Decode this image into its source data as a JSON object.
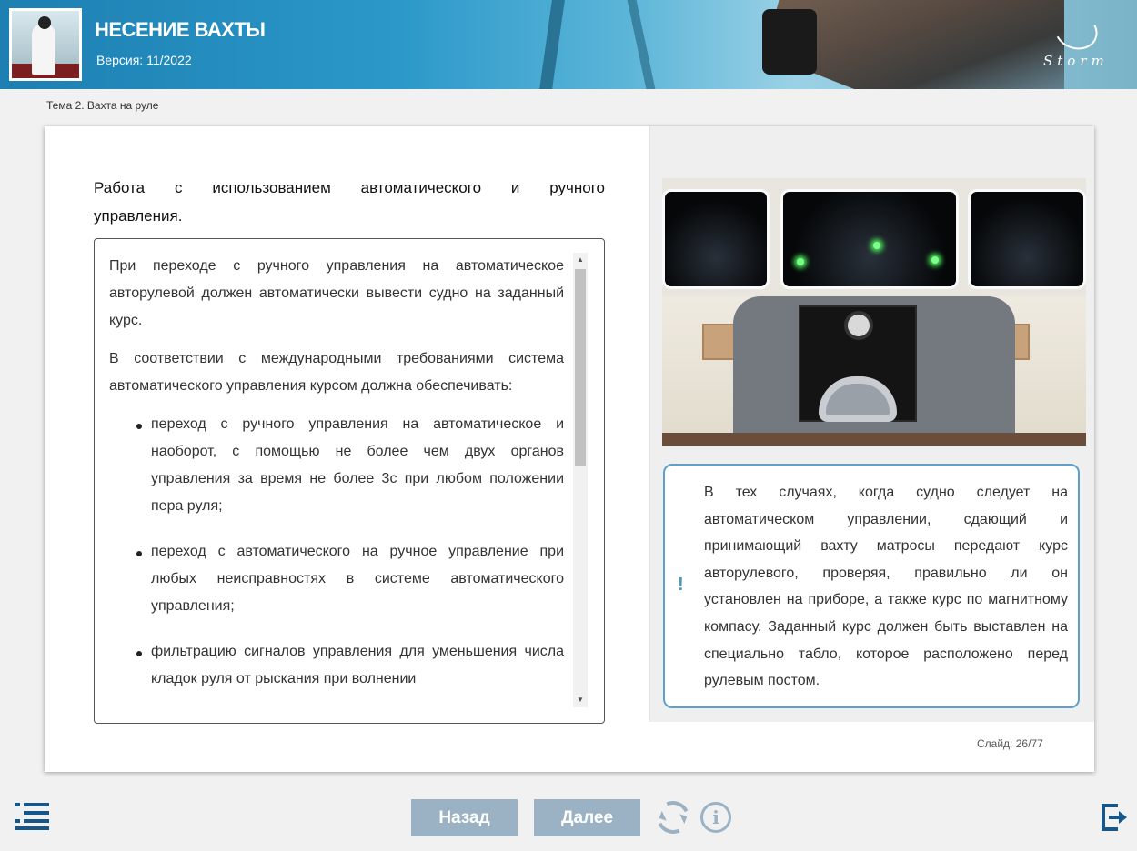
{
  "header": {
    "title": "НЕСЕНИЕ ВАХТЫ",
    "version": "Версия: 11/2022",
    "logo_text": "Storm"
  },
  "breadcrumb": "Тема 2. Вахта на руле",
  "main": {
    "heading_words": [
      "Работа",
      "с",
      "использованием",
      "автоматического",
      "и",
      "ручного"
    ],
    "heading_line2": "управления.",
    "paragraphs": [
      "При переходе с ручного управления на автоматическое авторулевой должен автоматически вывести судно на заданный курс.",
      "В соответствии с международными требованиями система автоматического управления курсом должна обеспечивать:"
    ],
    "bullets": [
      "переход с ручного управления на автоматическое и наоборот, с помощью не более чем двух органов управления за время не более 3с при любом положении пера руля;",
      "переход с автоматического на ручное управление при любых неисправностях в системе автоматического управления;",
      "фильтрацию сигналов управления для уменьшения числа кладок руля от рыскания при волнении"
    ],
    "scroll_position_percent": 0
  },
  "note": {
    "mark": "!",
    "text": "В тех случаях, когда судно следует на автоматическом управлении, сдающий и принимающий вахту матросы передают курс авторулевого, проверяя, правильно ли он установлен на приборе, а также курс по магнитному компасу. Заданный курс должен быть выставлен на специально табло, которое расположено перед рулевым постом."
  },
  "slide": {
    "label": "Слайд:",
    "current": "26",
    "total": "77"
  },
  "nav": {
    "back_label": "Назад",
    "next_label": "Далее",
    "info_glyph": "i"
  },
  "colors": {
    "accent": "#15578a",
    "nav_button": "#9ab2c3",
    "note_border": "#5ea0c9"
  },
  "icons": [
    "menu-icon",
    "reload-icon",
    "info-icon",
    "exit-icon"
  ]
}
